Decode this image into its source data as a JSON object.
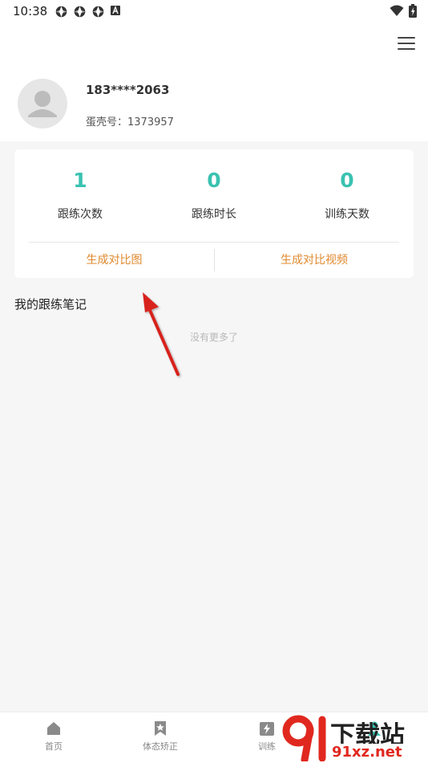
{
  "status_bar": {
    "time": "10:38"
  },
  "profile": {
    "phone": "183****2063",
    "shell_id": "蛋壳号：1373957"
  },
  "stats": [
    {
      "value": "1",
      "label": "跟练次数"
    },
    {
      "value": "0",
      "label": "跟练时长"
    },
    {
      "value": "0",
      "label": "训练天数"
    }
  ],
  "actions": {
    "compare_image": "生成对比图",
    "compare_video": "生成对比视频"
  },
  "notes": {
    "title": "我的跟练笔记",
    "empty_text": "没有更多了"
  },
  "bottom_nav": [
    {
      "label": "首页",
      "icon": "home-icon"
    },
    {
      "label": "体态矫正",
      "icon": "bookmark-star-icon"
    },
    {
      "label": "训练",
      "icon": "lightning-icon"
    }
  ],
  "watermark": {
    "brand": "下载站",
    "domain": "91xz.net"
  },
  "colors": {
    "accent_teal": "#3ac2b0",
    "accent_orange": "#e0892e",
    "arrow_red": "#d8201f"
  }
}
